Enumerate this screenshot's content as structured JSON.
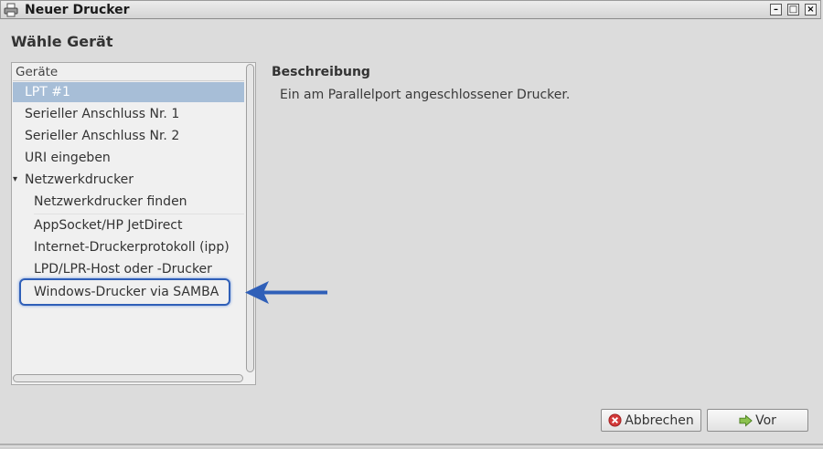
{
  "window": {
    "title": "Neuer Drucker",
    "buttons": {
      "minimize": "–",
      "maximize": "□",
      "close": "×"
    }
  },
  "page": {
    "heading": "Wähle Gerät"
  },
  "device_list": {
    "header": "Geräte",
    "items": [
      {
        "label": "LPT #1",
        "selected": true
      },
      {
        "label": "Serieller Anschluss Nr. 1"
      },
      {
        "label": "Serieller Anschluss Nr. 2"
      },
      {
        "label": "URI eingeben"
      },
      {
        "label": "Netzwerkdrucker",
        "expander": "▾"
      },
      {
        "label": "Netzwerkdrucker finden"
      },
      {
        "label": "AppSocket/HP JetDirect"
      },
      {
        "label": "Internet-Druckerprotokoll (ipp)"
      },
      {
        "label": "LPD/LPR-Host oder -Drucker"
      },
      {
        "label": "Windows-Drucker via SAMBA",
        "highlighted": true
      }
    ]
  },
  "description": {
    "label": "Beschreibung",
    "text": "Ein am Parallelport angeschlossener Drucker."
  },
  "footer": {
    "cancel_label": "Abbrechen",
    "next_label": "Vor"
  },
  "colors": {
    "selection": "#a7bed7",
    "annotation_arrow": "#2f5fb8",
    "cancel_icon": "#d33a3a",
    "forward_icon": "#6aab3a"
  },
  "icons": {
    "title": "printer-icon",
    "cancel": "cancel-icon",
    "forward": "forward-arrow-icon"
  }
}
